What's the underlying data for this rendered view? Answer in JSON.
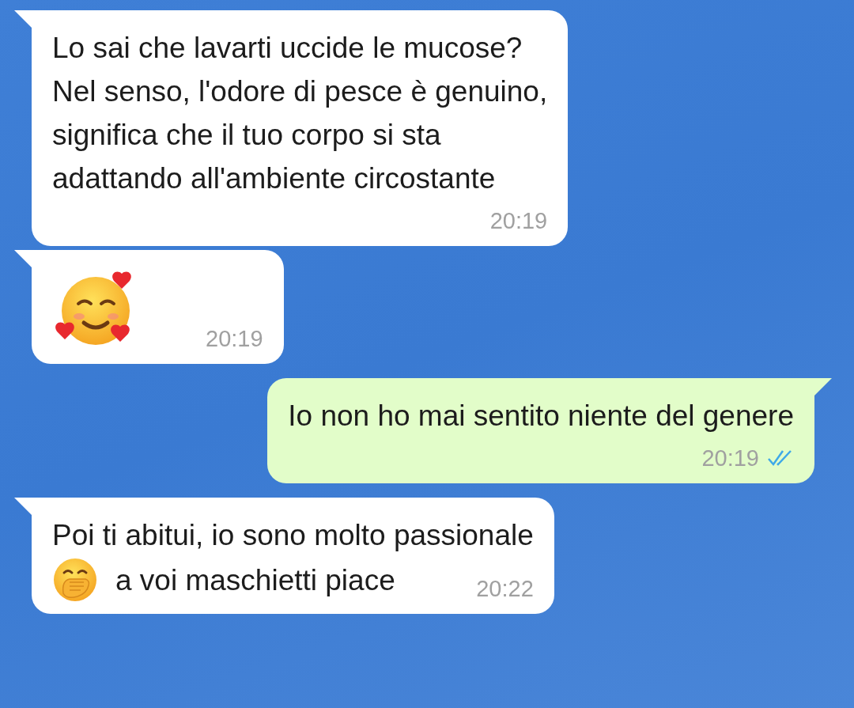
{
  "messages": [
    {
      "outgoing": false,
      "time": "20:19",
      "lines": [
        [
          {
            "kind": "text",
            "text": "Lo sai che lavarti uccide le mucose?\nNel senso, l'odore di pesce è genuino,\nsignifica che il tuo corpo si sta\nadattando all'ambiente circostante"
          }
        ]
      ]
    },
    {
      "outgoing": false,
      "time": "20:19",
      "lines": [
        [
          {
            "kind": "hearts"
          }
        ]
      ]
    },
    {
      "outgoing": true,
      "time": "20:19",
      "read": true,
      "lines": [
        [
          {
            "kind": "text",
            "text": "Io non ho mai sentito niente del genere"
          }
        ]
      ]
    },
    {
      "outgoing": false,
      "time": "20:22",
      "lines": [
        [
          {
            "kind": "text",
            "text": "Poi ti abitui, io sono molto passionale"
          }
        ],
        [
          {
            "kind": "hand"
          },
          {
            "kind": "text",
            "text": "a voi maschietti piace"
          }
        ]
      ]
    }
  ]
}
